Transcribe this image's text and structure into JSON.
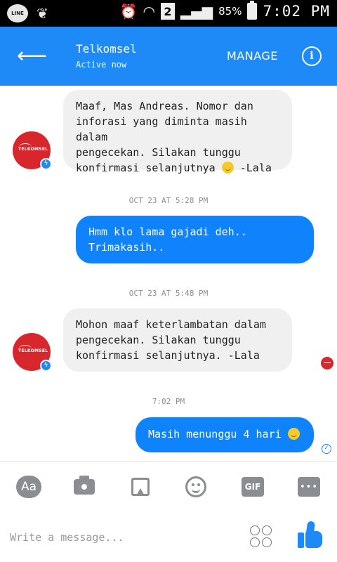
{
  "status_bar": {
    "line_label": "LINE",
    "sim_slot": "2",
    "battery_pct": "85%",
    "time": "7:02 PM"
  },
  "header": {
    "title": "Telkomsel",
    "subtitle": "Active now",
    "manage_label": "MANAGE",
    "info_label": "i"
  },
  "avatar_logo": "TELKOMSEL",
  "messages": [
    {
      "from": "them",
      "text": "Maaf, Mas Andreas. Nomor dan\ninforasi yang diminta masih dalam\npengecekan. Silakan tunggu\nkonfirmasi selanjutnya",
      "suffix": " -Lala",
      "emoji": "smile"
    },
    {
      "from": "me",
      "text": "Hmm klo lama gajadi deh..\nTrimakasih.."
    },
    {
      "from": "them",
      "text": "Mohon maaf  keterlambatan dalam\npengecekan. Silakan tunggu\nkonfirmasi selanjutnya. -Lala"
    },
    {
      "from": "me",
      "text": "Masih menunggu 4 hari",
      "emoji": "smile"
    }
  ],
  "timestamps": [
    "OCT 23 AT 5:28 PM",
    "OCT 23 AT 5:48 PM",
    "7:02 PM"
  ],
  "toolbar": {
    "text_label": "Aa",
    "gif_label": "GIF",
    "more_label": "•••"
  },
  "composer": {
    "placeholder": "Write a message..."
  }
}
